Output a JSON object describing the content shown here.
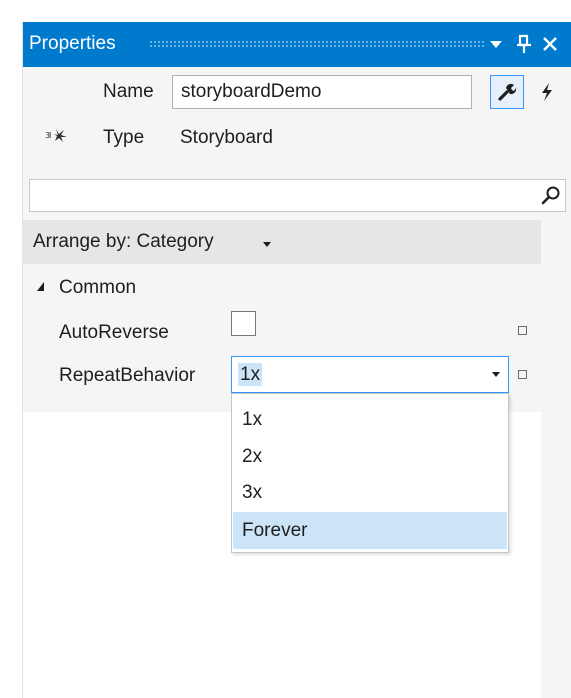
{
  "window": {
    "title": "Properties",
    "buttons": [
      "dropdown-arrow",
      "pin",
      "close"
    ]
  },
  "header": {
    "icon": "storyboard-glyph-icon",
    "name_label": "Name",
    "name_value": "storyboardDemo",
    "type_label": "Type",
    "type_value": "Storyboard",
    "properties_button_icon": "wrench-icon",
    "events_button_icon": "lightning-bolt-icon"
  },
  "search": {
    "value": "",
    "icon": "search-icon"
  },
  "arrange": {
    "label": "Arrange by: Category"
  },
  "category": {
    "name": "Common",
    "properties": [
      {
        "label": "AutoReverse",
        "checked": false
      },
      {
        "label": "RepeatBehavior",
        "value": "1x"
      }
    ]
  },
  "dropdown": {
    "options": [
      "1x",
      "2x",
      "3x",
      "Forever"
    ],
    "highlighted": "Forever"
  },
  "colors": {
    "titlebar": "#007acc",
    "accent": "#3399ff",
    "selection": "#cce4f7",
    "panel_bg": "#f5f5f5"
  }
}
